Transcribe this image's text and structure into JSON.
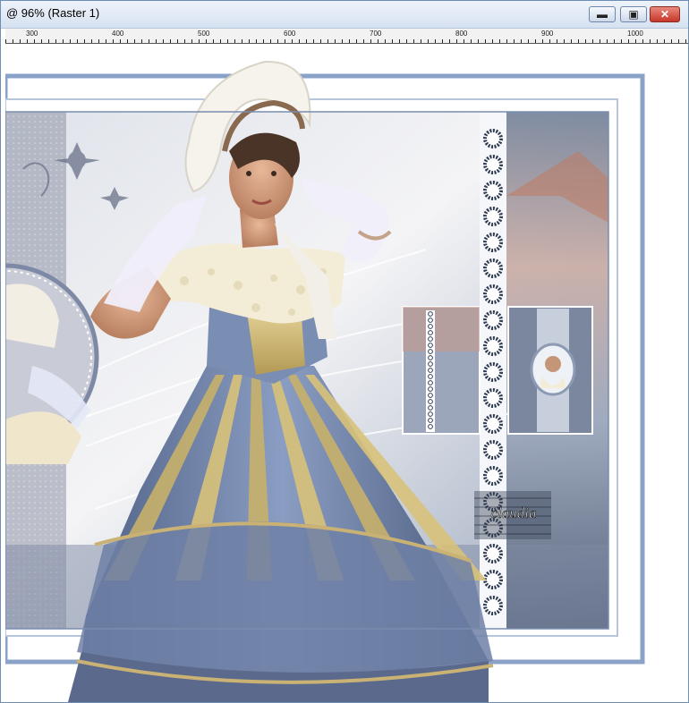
{
  "window": {
    "title": "@  96% (Raster 1)",
    "controls": {
      "minimize": "▬",
      "maximize": "▣",
      "close": "✕"
    }
  },
  "ruler": {
    "labels": [
      "300",
      "400",
      "500",
      "600",
      "700",
      "800",
      "900",
      "1000"
    ]
  },
  "artwork": {
    "watermark": "claudia",
    "colors": {
      "frame": "#8aa2c8",
      "gown_blue": "#6c82ab",
      "gown_gold": "#d8c27a",
      "lace": "#f3ecd6",
      "accent_copper": "#c27a5e"
    }
  }
}
